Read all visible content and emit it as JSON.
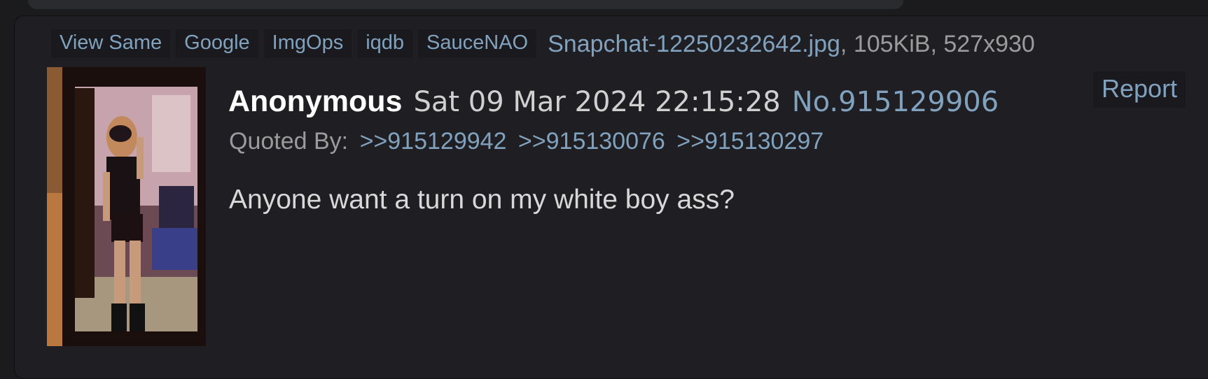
{
  "file_bar": {
    "buttons": [
      "View Same",
      "Google",
      "ImgOps",
      "iqdb",
      "SauceNAO"
    ],
    "file_name": "Snapchat-12250232642.jpg",
    "file_meta": ", 105KiB, 527x930"
  },
  "post": {
    "name": "Anonymous",
    "date": "Sat 09 Mar 2024 22:15:28",
    "number": "No.915129906",
    "report_label": "Report",
    "quoted_by_label": "Quoted By:",
    "quotes": [
      ">>915129942",
      ">>915130076",
      ">>915130297"
    ],
    "message": "Anyone want a turn on my white boy ass?"
  },
  "colors": {
    "link": "#81a2be",
    "background": "#1f1f23",
    "name": "#ffffff"
  }
}
